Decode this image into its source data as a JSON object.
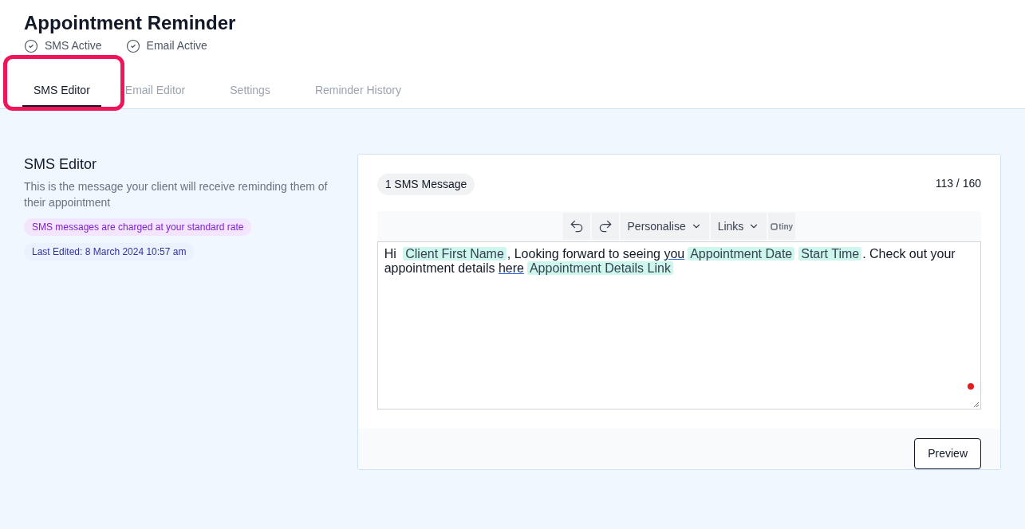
{
  "header": {
    "title": "Appointment Reminder",
    "statuses": [
      {
        "label": "SMS Active"
      },
      {
        "label": "Email Active"
      }
    ]
  },
  "tabs": [
    {
      "label": "SMS Editor",
      "selected": true,
      "highlighted": true
    },
    {
      "label": "Email Editor",
      "selected": false,
      "highlighted": false
    },
    {
      "label": "Settings",
      "selected": false,
      "highlighted": false
    },
    {
      "label": "Reminder History",
      "selected": false,
      "highlighted": false
    }
  ],
  "intro": {
    "title": "SMS Editor",
    "description": "This is the message your client will receive reminding them of their appointment",
    "notice": "SMS messages are charged at your standard rate",
    "last_edited": "Last Edited: 8 March 2024 10:57 am"
  },
  "editor": {
    "message_count": "1 SMS Message",
    "char_count": "113 / 160",
    "toolbar": {
      "menus": [
        {
          "label": "Personalise"
        },
        {
          "label": "Links"
        }
      ],
      "brand": "tiny"
    },
    "content": [
      {
        "kind": "text",
        "text": "Hi "
      },
      {
        "kind": "token",
        "text": "Client First Name"
      },
      {
        "kind": "text",
        "text": ", Looking forward to seeing "
      },
      {
        "kind": "link",
        "text": "you"
      },
      {
        "kind": "token",
        "text": "Appointment Date"
      },
      {
        "kind": "token",
        "text": "Start Time"
      },
      {
        "kind": "text",
        "text": ". Check out your appointment details "
      },
      {
        "kind": "link",
        "text": "here"
      },
      {
        "kind": "token",
        "text": "Appointment Details Link"
      }
    ],
    "preview_button": "Preview"
  }
}
